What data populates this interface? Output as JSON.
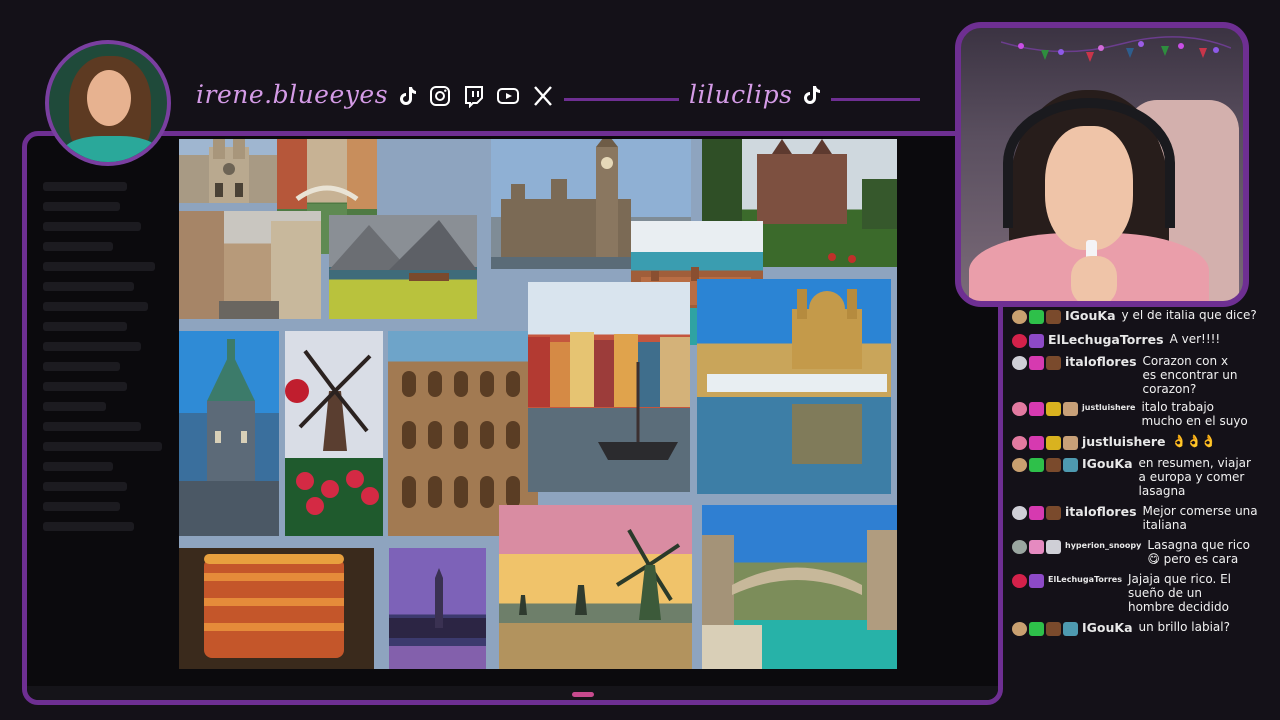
{
  "header": {
    "handle_main": "irene.blueeyes",
    "handle_clips": "liluclips",
    "social_icons": [
      "tiktok-icon",
      "instagram-icon",
      "twitch-icon",
      "youtube-icon",
      "x-icon"
    ],
    "clips_icon": "tiktok-icon"
  },
  "colors": {
    "frame": "#6e2f92",
    "handle_text": "#d49be6",
    "background": "#141118",
    "chat_text": "#f1f1f1"
  },
  "collage": {
    "tiles": [
      "notre-dame",
      "venice-canal",
      "big-ben",
      "castle",
      "paris-street",
      "lake-meadow",
      "coastal-town",
      "edinburgh-tower",
      "windmill-tulips",
      "colosseum",
      "nyhavn-copenhagen",
      "malta-harbor",
      "lasagna",
      "london-dusk",
      "kinderdijk-windmills",
      "mostar-bridge"
    ]
  },
  "chat": {
    "messages": [
      {
        "user": "IGouKa",
        "text": "y el de italia que dice?",
        "partial": true
      },
      {
        "user": "ElLechugaTorres",
        "text": "A ver!!!!"
      },
      {
        "user": "italoflores",
        "text": "Corazon con x es encontrar un corazon?"
      },
      {
        "user": "justluishere",
        "text": "italo trabajo mucho en el suyo"
      },
      {
        "user": "justluishere",
        "text": "👌👌👌"
      },
      {
        "user": "IGouKa",
        "text": "en resumen, viajar a europa y comer lasagna"
      },
      {
        "user": "italoflores",
        "text": "Mejor comerse una italiana"
      },
      {
        "user": "hyperion_snoopy",
        "text": "Lasagna que rico 😋 pero es cara"
      },
      {
        "user": "ElLechugaTorres",
        "text": "Jajaja que rico. El sueño de un hombre decidido"
      },
      {
        "user": "IGouKa",
        "text": "un brillo labial?"
      }
    ]
  }
}
